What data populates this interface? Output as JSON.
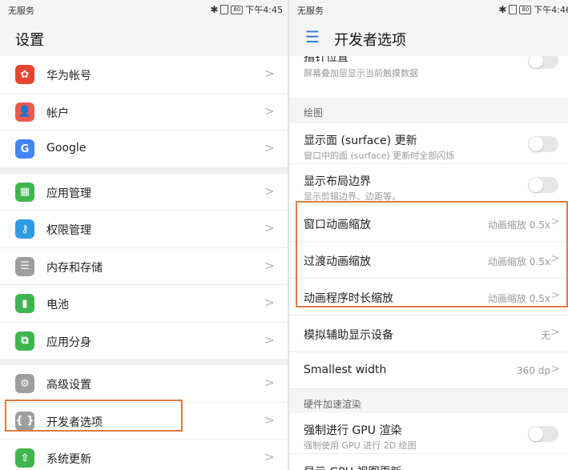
{
  "left": {
    "status": {
      "carrier": "无服务",
      "battery": "80",
      "time": "下午4:45"
    },
    "title": "设置",
    "groups": [
      [
        {
          "label": "华为帐号",
          "icon": "huawei-icon",
          "color": "#e8452f",
          "glyph": "✿"
        },
        {
          "label": "帐户",
          "icon": "account-icon",
          "color": "#f05a50",
          "glyph": "👤"
        },
        {
          "label": "Google",
          "icon": "google-icon",
          "color": "#4285f4",
          "glyph": "G"
        }
      ],
      [
        {
          "label": "应用管理",
          "icon": "apps-icon",
          "color": "#3fb54f",
          "glyph": "▦"
        },
        {
          "label": "权限管理",
          "icon": "key-icon",
          "color": "#2e9be5",
          "glyph": "⚷"
        },
        {
          "label": "内存和存储",
          "icon": "storage-icon",
          "color": "#9e9e9e",
          "glyph": "☰"
        },
        {
          "label": "电池",
          "icon": "battery-icon",
          "color": "#3fb54f",
          "glyph": "▮"
        },
        {
          "label": "应用分身",
          "icon": "twin-app-icon",
          "color": "#3fb54f",
          "glyph": "⧉"
        }
      ],
      [
        {
          "label": "高级设置",
          "icon": "gear-icon",
          "color": "#9e9e9e",
          "glyph": "⚙"
        },
        {
          "label": "开发者选项",
          "icon": "developer-icon",
          "color": "#9e9e9e",
          "glyph": "{ }"
        },
        {
          "label": "系统更新",
          "icon": "update-icon",
          "color": "#3fb54f",
          "glyph": "⇧"
        }
      ]
    ]
  },
  "right": {
    "status": {
      "carrier": "无服务",
      "battery": "80",
      "time": "下午4:46"
    },
    "title": "开发者选项",
    "top_cut_title": "指针位置",
    "top_sub": "屏幕叠加层显示当前触摸数据",
    "section_drawing": "绘图",
    "surface_title": "显示面 (surface) 更新",
    "surface_sub": "窗口中的面 (surface) 更新时全部闪烁",
    "layout_title": "显示布局边界",
    "layout_sub": "显示剪辑边界、边距等。",
    "window_anim": "窗口动画缩放",
    "transition_anim": "过渡动画缩放",
    "animator_duration": "动画程序时长缩放",
    "anim_value": "动画缩放 0.5x",
    "simulate_display": "模拟辅助显示设备",
    "simulate_value": "无",
    "smallest_width": "Smallest width",
    "smallest_value": "360 dp",
    "section_hw": "硬件加速渲染",
    "gpu_title": "强制进行 GPU 渲染",
    "gpu_sub": "强制使用 GPU 进行 2D 绘图",
    "gpu_view_cut": "显示 GPU 视图更新"
  }
}
